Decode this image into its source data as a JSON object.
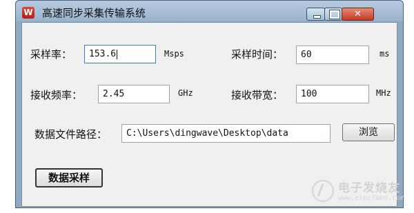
{
  "window": {
    "title": "高速同步采集传输系统",
    "icon_letter": "W",
    "close_glyph": "✕"
  },
  "form": {
    "sample_rate_label": "采样率：",
    "sample_rate_value": "153.6",
    "sample_rate_unit": "Msps",
    "sample_time_label": "采样时间：",
    "sample_time_value": "60",
    "sample_time_unit": "ms",
    "rx_freq_label": "接收频率：",
    "rx_freq_value": "2.45",
    "rx_freq_unit": "GHz",
    "rx_bw_label": "接收带宽：",
    "rx_bw_value": "100",
    "rx_bw_unit": "MHz",
    "path_label": "数据文件路径：",
    "path_value": "C:\\Users\\dingwave\\Desktop\\data",
    "browse_label": "浏览"
  },
  "actions": {
    "acquire_label": "数据采样"
  },
  "watermark": {
    "text": "电子发烧友",
    "url": "www.elecfans.com"
  }
}
